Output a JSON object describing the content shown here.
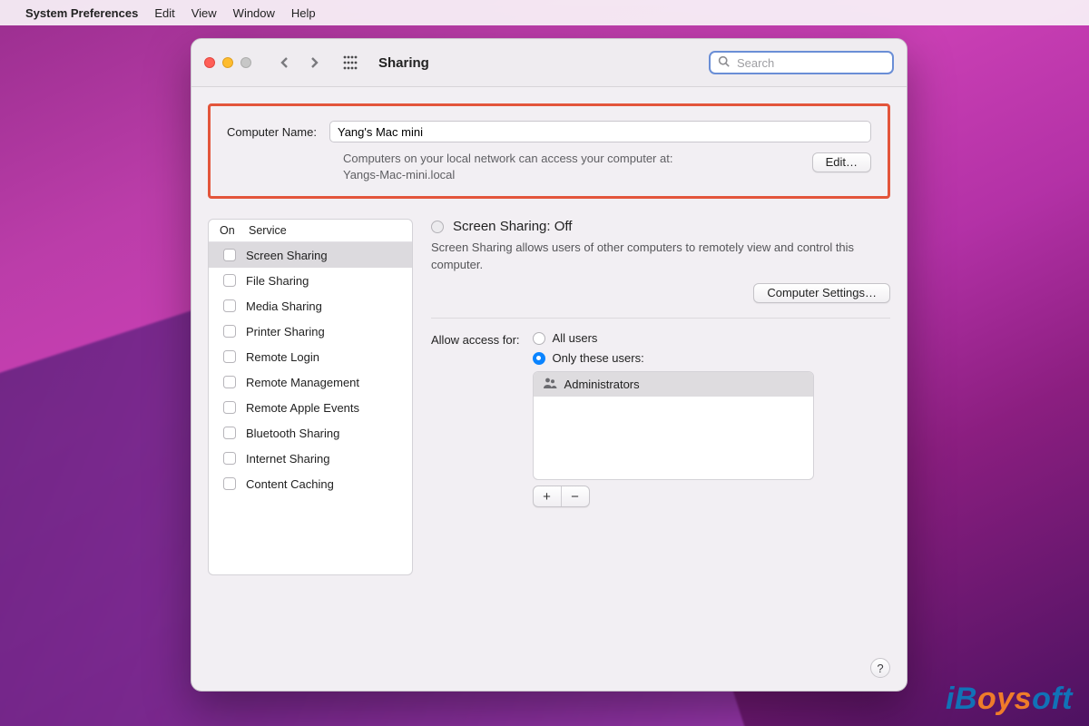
{
  "menubar": {
    "app": "System Preferences",
    "items": [
      "Edit",
      "View",
      "Window",
      "Help"
    ]
  },
  "window": {
    "title": "Sharing",
    "search_placeholder": "Search"
  },
  "computer_name": {
    "label": "Computer Name:",
    "value": "Yang's Mac mini",
    "sub1": "Computers on your local network can access your computer at:",
    "sub2": "Yangs-Mac-mini.local",
    "edit_label": "Edit…"
  },
  "services": {
    "header_on": "On",
    "header_service": "Service",
    "items": [
      {
        "label": "Screen Sharing",
        "checked": false,
        "selected": true
      },
      {
        "label": "File Sharing",
        "checked": false,
        "selected": false
      },
      {
        "label": "Media Sharing",
        "checked": false,
        "selected": false
      },
      {
        "label": "Printer Sharing",
        "checked": false,
        "selected": false
      },
      {
        "label": "Remote Login",
        "checked": false,
        "selected": false
      },
      {
        "label": "Remote Management",
        "checked": false,
        "selected": false
      },
      {
        "label": "Remote Apple Events",
        "checked": false,
        "selected": false
      },
      {
        "label": "Bluetooth Sharing",
        "checked": false,
        "selected": false
      },
      {
        "label": "Internet Sharing",
        "checked": false,
        "selected": false
      },
      {
        "label": "Content Caching",
        "checked": false,
        "selected": false
      }
    ]
  },
  "detail": {
    "status_title": "Screen Sharing: Off",
    "status_desc": "Screen Sharing allows users of other computers to remotely view and control this computer.",
    "computer_settings_label": "Computer Settings…",
    "access_label": "Allow access for:",
    "opt_all": "All users",
    "opt_only": "Only these users:",
    "users": [
      "Administrators"
    ],
    "add_label": "+",
    "rem_label": "−",
    "help_label": "?"
  },
  "watermark": {
    "text_a": "iB",
    "text_b": "oys",
    "text_c": "oft"
  }
}
